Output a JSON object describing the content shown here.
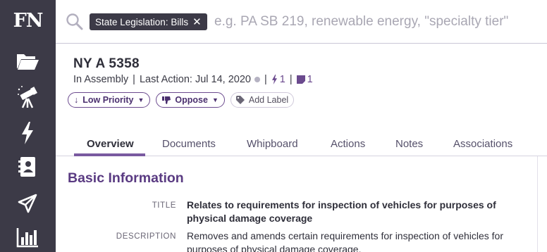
{
  "app": {
    "logo": "FN"
  },
  "sidebar": {
    "items": [
      {
        "name": "folder-icon"
      },
      {
        "name": "telescope-icon"
      },
      {
        "name": "lightning-icon"
      },
      {
        "name": "contact-book-icon"
      },
      {
        "name": "paper-plane-icon"
      },
      {
        "name": "bar-chart-icon"
      }
    ]
  },
  "search": {
    "filter_chip": "State Legislation: Bills",
    "chip_close": "✕",
    "placeholder": "e.g. PA SB 219, renewable energy, \"specialty tier\""
  },
  "bill": {
    "id": "NY A 5358",
    "status": "In Assembly",
    "last_action": "Last Action: Jul 14, 2020",
    "actions_count": "1",
    "notes_count": "1",
    "priority_label": "Low Priority",
    "position_label": "Oppose",
    "add_label": "Add Label"
  },
  "tabs": [
    "Overview",
    "Documents",
    "Whipboard",
    "Actions",
    "Notes",
    "Associations"
  ],
  "section": {
    "title": "Basic Information",
    "fields": [
      {
        "label": "TITLE",
        "value": "Relates to requirements for inspection of vehicles for purposes of physical damage coverage"
      },
      {
        "label": "DESCRIPTION",
        "value": "Removes and amends certain requirements for inspection of vehicles for purposes of physical damage coverage."
      }
    ]
  },
  "colors": {
    "sidebar_bg": "#3c3a47",
    "accent_purple": "#6b4a8e",
    "section_title": "#5a3b82"
  }
}
